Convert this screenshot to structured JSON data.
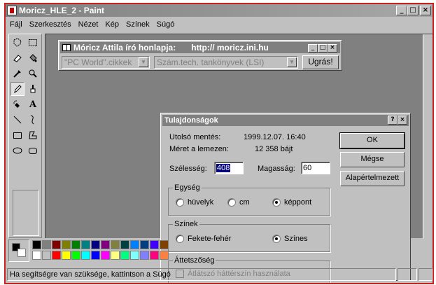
{
  "window": {
    "title": "Moricz_HLE_2 - Paint",
    "buttons": {
      "minimize": "_",
      "maximize": "□",
      "close": "×"
    }
  },
  "menu": [
    {
      "label": "Fájl"
    },
    {
      "label": "Szerkesztés"
    },
    {
      "label": "Nézet"
    },
    {
      "label": "Kép"
    },
    {
      "label": "Színek"
    },
    {
      "label": "Súgó"
    }
  ],
  "webbar": {
    "title": "Móricz Attila író honlapja:",
    "url": "http:// moricz.ini.hu",
    "combo1": "\"PC World\".cikkek",
    "combo2": "Szám.tech. tankönyvek (LSI)",
    "go_button": "Ugrás!"
  },
  "dialog": {
    "title": "Tulajdonságok",
    "help": "?",
    "close": "×",
    "last_saved_label": "Utolsó mentés:",
    "last_saved_value": "1999.12.07. 16:40",
    "size_label": "Méret a lemezen:",
    "size_value": "12 358 bájt",
    "width_label": "Szélesség:",
    "width_value": "408",
    "height_label": "Magasság:",
    "height_value": "60",
    "ok": "OK",
    "cancel": "Mégse",
    "default": "Alapértelmezett",
    "units_group": "Egység",
    "units": [
      {
        "label": "hüvelyk",
        "checked": false
      },
      {
        "label": "cm",
        "checked": false
      },
      {
        "label": "képpont",
        "checked": true
      }
    ],
    "colors_group": "Színek",
    "colors": [
      {
        "label": "Fekete-fehér",
        "checked": false
      },
      {
        "label": "Színes",
        "checked": true
      }
    ],
    "transparency_group": "Áttetszőség",
    "transparency_check": "Átlátszó háttérszín használata"
  },
  "status": {
    "text": "Ha segítségre van szüksége, kattintson a Súgó"
  },
  "palette_colors": [
    "#000000",
    "#808080",
    "#800000",
    "#808000",
    "#008000",
    "#008080",
    "#000080",
    "#800080",
    "#808040",
    "#004040",
    "#0080ff",
    "#004080",
    "#4000ff",
    "#804000",
    "#ffffff",
    "#c0c0c0",
    "#ff0000",
    "#ffff00",
    "#00ff00",
    "#00ffff",
    "#0000ff",
    "#ff00ff",
    "#ffff80",
    "#00ff80",
    "#80ffff",
    "#8080ff",
    "#ff0080",
    "#ff8040"
  ]
}
